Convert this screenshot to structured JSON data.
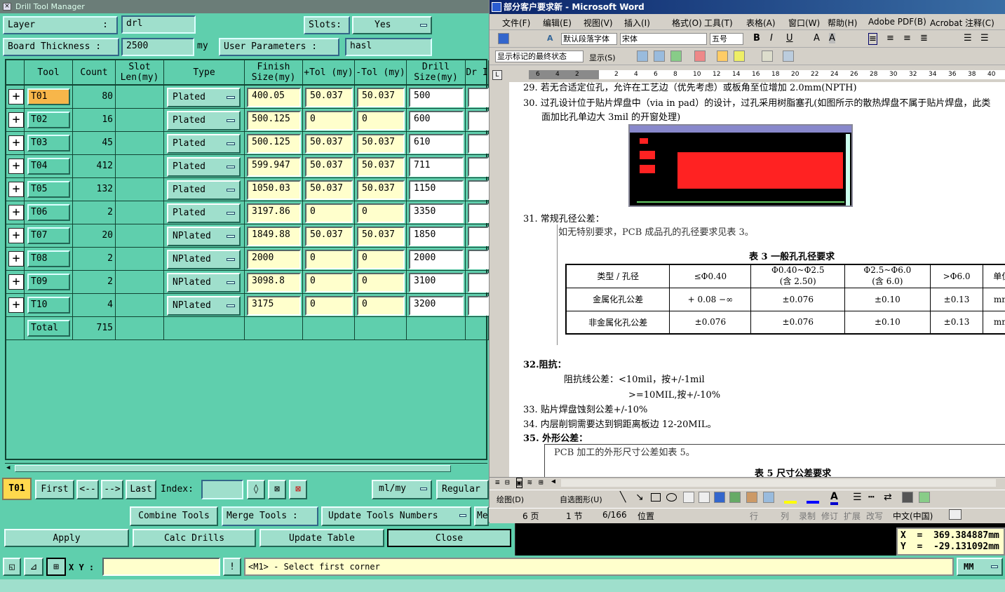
{
  "dtm": {
    "title": "Drill Tool Manager",
    "layer_label": "Layer",
    "layer_colon": ":",
    "layer_value": "drl",
    "slots_label": "Slots:",
    "slots_value": "Yes",
    "board_thickness_label": "Board Thickness :",
    "board_thickness_value": "2500",
    "board_thickness_unit": "my",
    "user_params_label": "User Parameters :",
    "user_params_value": "hasl",
    "columns": [
      "Tool",
      "Count",
      "Slot Len(my)",
      "Type",
      "Finish Size(my)",
      "+Tol (my)",
      "-Tol (my)",
      "Drill Size(my)",
      "Dr I"
    ],
    "rows": [
      {
        "tool": "T01",
        "count": "80",
        "type": "Plated",
        "finish": "400.05",
        "ptol": "50.037",
        "ntol": "50.037",
        "drill": "500"
      },
      {
        "tool": "T02",
        "count": "16",
        "type": "Plated",
        "finish": "500.125",
        "ptol": "0",
        "ntol": "0",
        "drill": "600"
      },
      {
        "tool": "T03",
        "count": "45",
        "type": "Plated",
        "finish": "500.125",
        "ptol": "50.037",
        "ntol": "50.037",
        "drill": "610"
      },
      {
        "tool": "T04",
        "count": "412",
        "type": "Plated",
        "finish": "599.947",
        "ptol": "50.037",
        "ntol": "50.037",
        "drill": "711"
      },
      {
        "tool": "T05",
        "count": "132",
        "type": "Plated",
        "finish": "1050.03",
        "ptol": "50.037",
        "ntol": "50.037",
        "drill": "1150"
      },
      {
        "tool": "T06",
        "count": "2",
        "type": "Plated",
        "finish": "3197.86",
        "ptol": "0",
        "ntol": "0",
        "drill": "3350"
      },
      {
        "tool": "T07",
        "count": "20",
        "type": "NPlated",
        "finish": "1849.88",
        "ptol": "50.037",
        "ntol": "50.037",
        "drill": "1850"
      },
      {
        "tool": "T08",
        "count": "2",
        "type": "NPlated",
        "finish": "2000",
        "ptol": "0",
        "ntol": "0",
        "drill": "2000"
      },
      {
        "tool": "T09",
        "count": "2",
        "type": "NPlated",
        "finish": "3098.8",
        "ptol": "0",
        "ntol": "0",
        "drill": "3100"
      },
      {
        "tool": "T10",
        "count": "4",
        "type": "NPlated",
        "finish": "3175",
        "ptol": "0",
        "ntol": "0",
        "drill": "3200"
      }
    ],
    "total_label": "Total",
    "total_count": "715",
    "nav": {
      "current": "T01",
      "first": "First",
      "prev": "<--",
      "next": "-->",
      "last": "Last",
      "index_label": "Index:",
      "units": "ml/my",
      "regular": "Regular"
    },
    "actions": {
      "combine": "Combine Tools",
      "merge": "Merge Tools :",
      "update_numbers": "Update Tools Numbers",
      "me": "Me"
    },
    "bottom": {
      "apply": "Apply",
      "calc": "Calc Drills",
      "update_table": "Update Table",
      "close": "Close"
    }
  },
  "word": {
    "title": "部分客户要求新 - Microsoft Word",
    "menus": [
      "文件(F)",
      "编辑(E)",
      "视图(V)",
      "插入(I)",
      "格式(O)",
      "工具(T)",
      "表格(A)",
      "窗口(W)",
      "帮助(H)",
      "Adobe PDF(B)",
      "Acrobat 注释(C)"
    ],
    "style_box": "默认段落字体",
    "font_box": "宋体",
    "size_box": "五号",
    "markup_box": "显示标记的最终状态",
    "show_label": "显示(S)",
    "ruler": [
      "6",
      "4",
      "2",
      "",
      "2",
      "4",
      "6",
      "8",
      "10",
      "12",
      "14",
      "16",
      "18",
      "20",
      "22",
      "24",
      "26",
      "28",
      "30",
      "32",
      "34",
      "36",
      "38",
      "40"
    ],
    "lines": {
      "l29": "29.  若无合适定位孔，允许在工艺边（优先考虑）或板角至位增加 2.0mm(NPTH)",
      "l30a": "30.  过孔设计位于贴片焊盘中（via in pad）的设计，过孔采用树脂塞孔(如图所示的散热焊盘不属于贴片焊盘，此类",
      "l30b": "面加比孔单边大 3mil 的开窗处理)",
      "l31": "31.  常规孔径公差：",
      "l31b": "如无特别要求，PCB 成品孔的孔径要求见表 3。",
      "table3_title": "表 3    一般孔孔径要求",
      "l32": "32.阻抗：",
      "l32a": "阻抗线公差：<10mil，按+/-1mil",
      "l32b": ">=10MIL,按+/-10%",
      "l33": "33.  贴片焊盘蚀刻公差+/-10%",
      "l34": "34.  内层削铜需要达到铜距离板边 12-20MIL。",
      "l35": "35.  外形公差：",
      "l35a": "PCB 加工的外形尺寸公差如表 5。",
      "table5_title": "表 5    尺寸公差要求"
    },
    "table3": {
      "header": [
        "类型 / 孔径",
        "≤Φ0.40",
        "Φ0.40~Φ2.5\n(含 2.50)",
        "Φ2.5~Φ6.0\n(含 6.0)",
        ">Φ6.0",
        "单位"
      ],
      "row1": [
        "金属化孔公差",
        "+ 0.08 −∞",
        "±0.076",
        "±0.10",
        "±0.13",
        "mm"
      ],
      "row2": [
        "非金属化孔公差",
        "±0.076",
        "±0.076",
        "±0.10",
        "±0.13",
        "mm"
      ]
    },
    "draw_bar": {
      "draw": "绘图(D)",
      "autoshape": "自选图形(U)"
    },
    "status": {
      "page": "6 页",
      "section": "1 节",
      "pos": "6/166",
      "loc": "位置",
      "line": "行",
      "col": "列",
      "rec": "录制",
      "trk": "修订",
      "ext": "扩展",
      "ovr": "改写",
      "lang": "中文(中国)"
    }
  },
  "coords": {
    "x": "X  =  369.384887mm",
    "y": "Y  =  -29.131092mm"
  },
  "cmd": {
    "xy_label": "X Y :",
    "prompt": "<M1> - Select first corner",
    "units": "MM"
  }
}
